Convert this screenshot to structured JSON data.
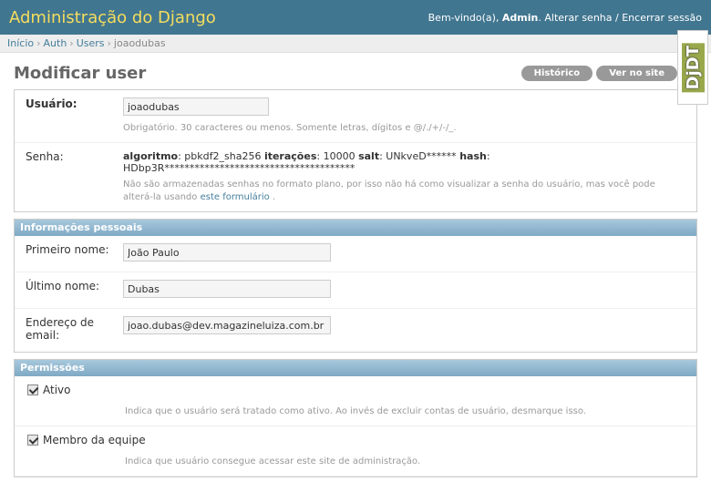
{
  "header": {
    "branding": "Administração do Django",
    "welcome": "Bem-vindo(a),",
    "username": "Admin",
    "change_password": "Alterar senha",
    "separator": " / ",
    "logout": "Encerrar sessão"
  },
  "breadcrumbs": {
    "home": "Início",
    "app": "Auth",
    "model": "Users",
    "current": "joaodubas",
    "sep": "›"
  },
  "page": {
    "title": "Modificar user",
    "history_button": "Histórico",
    "view_site_button": "Ver no site"
  },
  "account": {
    "username_label": "Usuário:",
    "username_value": "joaodubas",
    "username_help": "Obrigatório. 30 caracteres ou menos. Somente letras, dígitos e @/./+/-/_.",
    "password_label": "Senha:",
    "password_summary": {
      "algorithm_key": "algoritmo",
      "algorithm_value": ": pbkdf2_sha256 ",
      "iterations_key": "iterações",
      "iterations_value": ": 10000 ",
      "salt_key": "salt",
      "salt_value": ": UNkveD****** ",
      "hash_key": "hash",
      "hash_value": ": HDbp3R**************************************"
    },
    "password_help_text": "Não são armazenadas senhas no formato plano, por isso não há como visualizar a senha do usuário, mas você pode alterá-la usando ",
    "password_help_link": "este formulário",
    "password_help_end": " ."
  },
  "personal_info": {
    "heading": "Informações pessoais",
    "first_name_label": "Primeiro nome:",
    "first_name_value": "João Paulo",
    "last_name_label": "Último nome:",
    "last_name_value": "Dubas",
    "email_label": "Endereço de email:",
    "email_value": "joao.dubas@dev.magazineluiza.com.br"
  },
  "permissions": {
    "heading": "Permissões",
    "items": [
      {
        "label": "Ativo",
        "help": "Indica que o usuário será tratado como ativo. Ao invés de excluir contas de usuário, desmarque isso.",
        "checked": true
      },
      {
        "label": "Membro da equipe",
        "help": "Indica que usuário consegue acessar este site de administração.",
        "checked": true
      }
    ]
  },
  "debug_toolbar": {
    "label": "DjDT"
  },
  "colors": {
    "header_bg": "#417690",
    "branding": "#f5dd5d",
    "module_heading": "#7fa9c5",
    "link": "#447e9b"
  }
}
